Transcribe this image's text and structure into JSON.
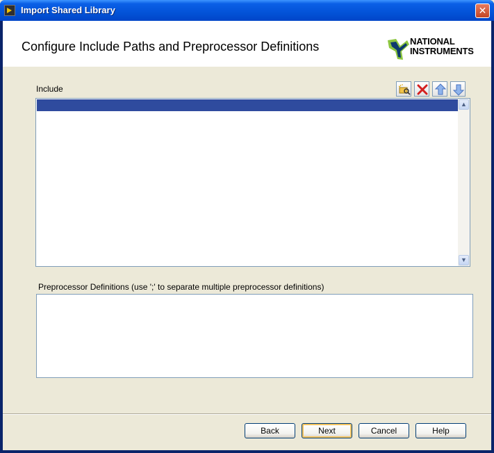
{
  "window": {
    "title": "Import Shared Library",
    "close_glyph": "✕"
  },
  "header": {
    "title": "Configure Include Paths and Preprocessor Definitions",
    "logo": {
      "line1": "NATIONAL",
      "line2": "INSTRUMENTS"
    }
  },
  "include": {
    "label": "Include",
    "toolbar": [
      {
        "name": "browse-folder-icon"
      },
      {
        "name": "delete-icon"
      },
      {
        "name": "move-up-icon"
      },
      {
        "name": "move-down-icon"
      }
    ],
    "items": [
      ""
    ],
    "selected_index": 0
  },
  "preprocessor": {
    "label": "Preprocessor Definitions (use ';' to separate multiple preprocessor definitions)",
    "value": ""
  },
  "buttons": {
    "back": "Back",
    "next": "Next",
    "cancel": "Cancel",
    "help": "Help"
  },
  "colors": {
    "title_bar": "#0353d8",
    "selection": "#2f4b9e",
    "dialog_bg": "#ece9d8",
    "logo_green": "#8cc63f"
  }
}
